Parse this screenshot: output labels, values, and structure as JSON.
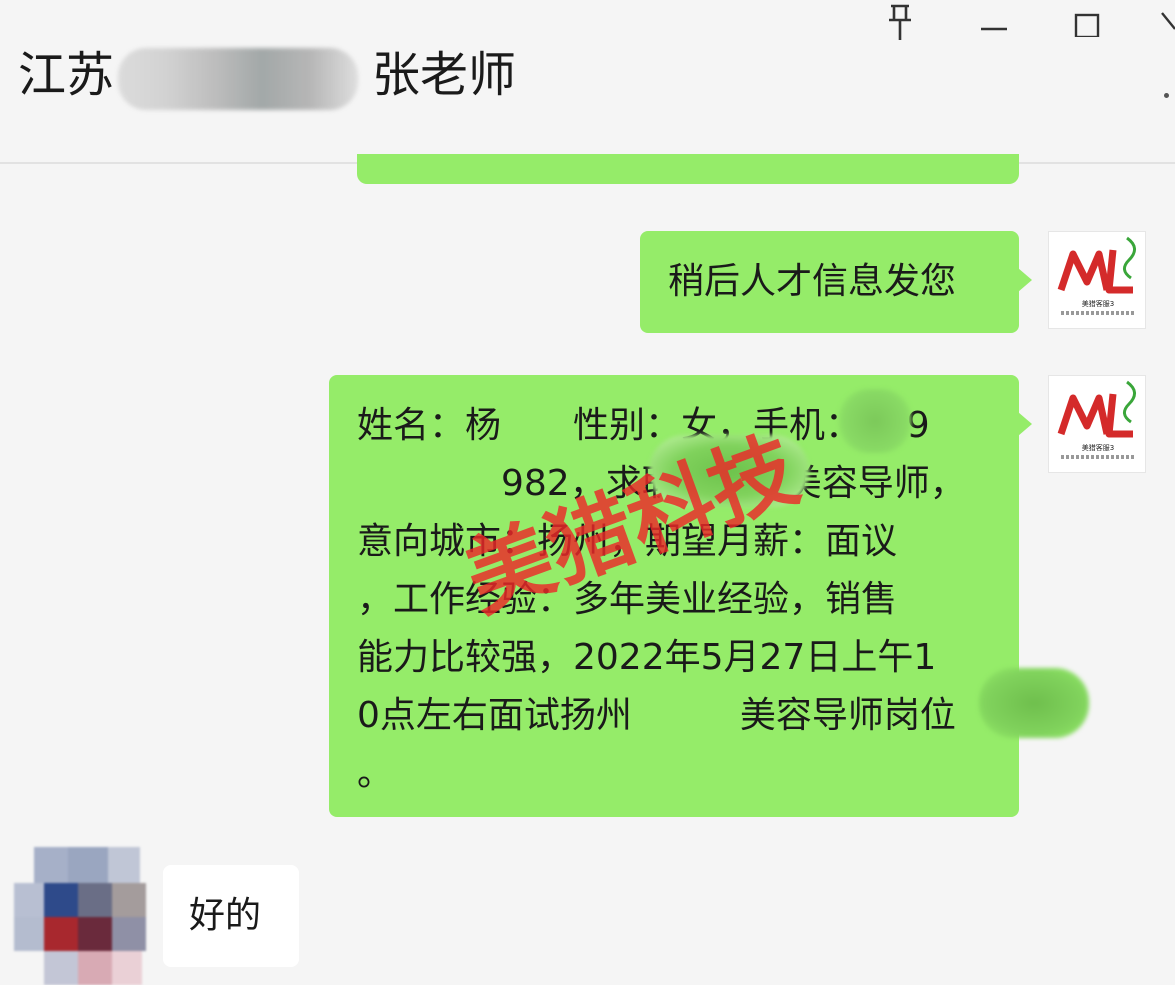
{
  "window": {
    "title_prefix": "江苏",
    "title_suffix": "张老师",
    "controls": {
      "pin_icon": "pin-icon",
      "minimize_icon": "minimize-icon",
      "maximize_icon": "maximize-icon",
      "close_icon": "close-icon"
    }
  },
  "messages": [
    {
      "side": "right",
      "text": "稍后人才信息发您"
    },
    {
      "side": "right",
      "lines": [
        "姓名：杨　　性别：女，手机：189",
        "　　　　982，求职岗位：美容导师，",
        "意向城市：扬州，期望月薪：面议",
        "，工作经验：多年美业经验，销售",
        "能力比较强，2022年5月27日上午1",
        "0点左右面试扬州　　　美容导师岗位",
        "。"
      ]
    },
    {
      "side": "left",
      "text": "好的"
    }
  ],
  "avatar_right": {
    "logo_text": "ML",
    "label": "美猎客服3"
  },
  "watermark": {
    "text": "美猎科技",
    "color": "#eb2828"
  },
  "colors": {
    "bubble_self": "#95ec69",
    "bubble_other": "#ffffff",
    "background": "#f5f5f5"
  }
}
